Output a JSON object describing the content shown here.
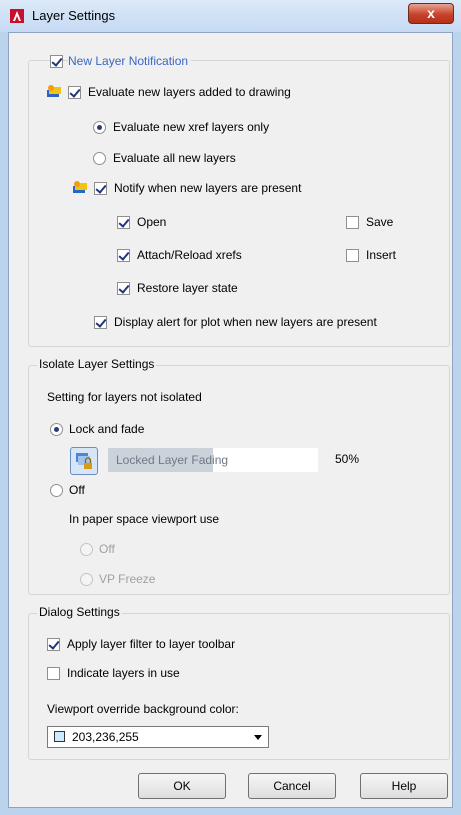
{
  "window": {
    "title": "Layer Settings",
    "close_glyph": "x"
  },
  "new_layer_notification": {
    "label": "New Layer Notification",
    "checked": true,
    "evaluate_label": "Evaluate new layers added to drawing",
    "evaluate_checked": true,
    "xref_only_label": "Evaluate new xref layers only",
    "all_layers_label": "Evaluate all new layers",
    "evaluate_mode": "xref_only",
    "notify_label": "Notify when new layers are present",
    "notify_checked": true,
    "open_label": "Open",
    "open_checked": true,
    "save_label": "Save",
    "save_checked": false,
    "attach_label": "Attach/Reload xrefs",
    "attach_checked": true,
    "insert_label": "Insert",
    "insert_checked": false,
    "restore_label": "Restore layer state",
    "restore_checked": true,
    "plot_alert_label": "Display alert for plot when new layers are present",
    "plot_alert_checked": true
  },
  "isolate": {
    "title": "Isolate Layer Settings",
    "subtitle": "Setting for layers not isolated",
    "lock_fade_label": "Lock and fade",
    "mode": "lock_and_fade",
    "fade_field_label": "Locked Layer Fading",
    "fade_percent_text": "50%",
    "fade_fraction": 0.5,
    "off_label": "Off",
    "paper_space_label": "In paper space viewport use",
    "vp_off_label": "Off",
    "vp_freeze_label": "VP Freeze"
  },
  "dialog": {
    "title": "Dialog Settings",
    "apply_filter_label": "Apply layer filter to layer toolbar",
    "apply_filter_checked": true,
    "indicate_label": "Indicate layers in use",
    "indicate_checked": false,
    "bg_color_label": "Viewport override background color:",
    "bg_color_value": "203,236,255",
    "bg_color_swatch": "#cbecff"
  },
  "buttons": {
    "ok": "OK",
    "cancel": "Cancel",
    "help": "Help"
  },
  "colors": {
    "accent_blue_text": "#3a66c4",
    "close_button": "#c7432a",
    "title_bar": "#c5daf3"
  }
}
